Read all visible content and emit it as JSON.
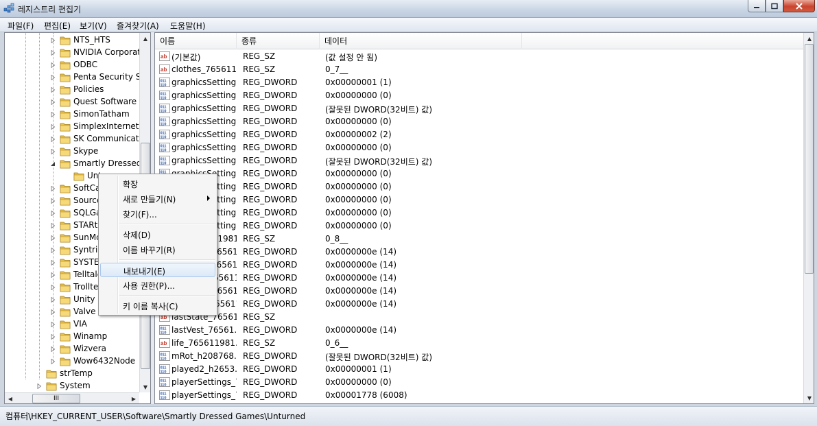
{
  "window": {
    "title": "레지스트리 편집기"
  },
  "menu": [
    "파일(F)",
    "편집(E)",
    "보기(V)",
    "즐겨찾기(A)",
    "도움말(H)"
  ],
  "tree": {
    "items": [
      {
        "label": "NTS_HTS"
      },
      {
        "label": "NVIDIA Corporati"
      },
      {
        "label": "ODBC"
      },
      {
        "label": "Penta Security Sy"
      },
      {
        "label": "Policies"
      },
      {
        "label": "Quest Software"
      },
      {
        "label": "SimonTatham"
      },
      {
        "label": "SimplexInternet"
      },
      {
        "label": "SK Communicatic"
      },
      {
        "label": "Skype"
      },
      {
        "label": "Smartly Dressed G"
      },
      {
        "label": "Unt"
      },
      {
        "label": "SoftCa"
      },
      {
        "label": "Source"
      },
      {
        "label": "SQLGa"
      },
      {
        "label": "STARtc"
      },
      {
        "label": "SunMc"
      },
      {
        "label": "Syntril"
      },
      {
        "label": "SYSTEI"
      },
      {
        "label": "Telltale"
      },
      {
        "label": "Trollted"
      },
      {
        "label": "Unity"
      },
      {
        "label": "Valve"
      },
      {
        "label": "VIA"
      },
      {
        "label": "Winamp"
      },
      {
        "label": "Wizvera"
      },
      {
        "label": "Wow6432Node"
      },
      {
        "label": "strTemp"
      },
      {
        "label": "System"
      }
    ],
    "hscroll_label": "III"
  },
  "list": {
    "columns": [
      "이름",
      "종류",
      "데이터"
    ],
    "rows": [
      {
        "icon": "string-value-icon",
        "name": "(기본값)",
        "type": "REG_SZ",
        "data": "(값 설정 안 됨)"
      },
      {
        "icon": "string-value-icon",
        "name": "clothes_765611...",
        "type": "REG_SZ",
        "data": "0_7__"
      },
      {
        "icon": "binary-value-icon",
        "name": "graphicsSetting...",
        "type": "REG_DWORD",
        "data": "0x00000001 (1)"
      },
      {
        "icon": "binary-value-icon",
        "name": "graphicsSetting...",
        "type": "REG_DWORD",
        "data": "0x00000000 (0)"
      },
      {
        "icon": "binary-value-icon",
        "name": "graphicsSetting...",
        "type": "REG_DWORD",
        "data": "(잘못된 DWORD(32비트) 값)"
      },
      {
        "icon": "binary-value-icon",
        "name": "graphicsSetting...",
        "type": "REG_DWORD",
        "data": "0x00000000 (0)"
      },
      {
        "icon": "binary-value-icon",
        "name": "graphicsSetting...",
        "type": "REG_DWORD",
        "data": "0x00000002 (2)"
      },
      {
        "icon": "binary-value-icon",
        "name": "graphicsSetting...",
        "type": "REG_DWORD",
        "data": "0x00000000 (0)"
      },
      {
        "icon": "binary-value-icon",
        "name": "graphicsSetting...",
        "type": "REG_DWORD",
        "data": "(잘못된 DWORD(32비트) 값)"
      },
      {
        "icon": "binary-value-icon",
        "name": "graphicsSetting...",
        "type": "REG_DWORD",
        "data": "0x00000000 (0)"
      },
      {
        "icon": "binary-value-icon",
        "name": "graphicsSetting...",
        "type": "REG_DWORD",
        "data": "0x00000000 (0)"
      },
      {
        "icon": "binary-value-icon",
        "name": "graphicsSetting...",
        "type": "REG_DWORD",
        "data": "0x00000000 (0)"
      },
      {
        "icon": "binary-value-icon",
        "name": "graphicsSetting...",
        "type": "REG_DWORD",
        "data": "0x00000000 (0)"
      },
      {
        "icon": "binary-value-icon",
        "name": "graphicsSetting...",
        "type": "REG_DWORD",
        "data": "0x00000000 (0)"
      },
      {
        "icon": "string-value-icon",
        "name": "hair_765611981...",
        "type": "REG_SZ",
        "data": "0_8__"
      },
      {
        "icon": "binary-value-icon",
        "name": "lastArms_765611...",
        "type": "REG_DWORD",
        "data": "0x0000000e (14)"
      },
      {
        "icon": "binary-value-icon",
        "name": "lastBody_765611...",
        "type": "REG_DWORD",
        "data": "0x0000000e (14)"
      },
      {
        "icon": "binary-value-icon",
        "name": "lastFeet_765611...",
        "type": "REG_DWORD",
        "data": "0x0000000e (14)"
      },
      {
        "icon": "binary-value-icon",
        "name": "lastHead_765611...",
        "type": "REG_DWORD",
        "data": "0x0000000e (14)"
      },
      {
        "icon": "binary-value-icon",
        "name": "lastLegs_765611...",
        "type": "REG_DWORD",
        "data": "0x0000000e (14)"
      },
      {
        "icon": "string-value-icon",
        "name": "lastState_76561...",
        "type": "REG_SZ",
        "data": ""
      },
      {
        "icon": "binary-value-icon",
        "name": "lastVest_76561...",
        "type": "REG_DWORD",
        "data": "0x0000000e (14)"
      },
      {
        "icon": "string-value-icon",
        "name": "life_765611981...",
        "type": "REG_SZ",
        "data": "0_6__"
      },
      {
        "icon": "binary-value-icon",
        "name": "mRot_h208768...",
        "type": "REG_DWORD",
        "data": "(잘못된 DWORD(32비트) 값)"
      },
      {
        "icon": "binary-value-icon",
        "name": "played2_h2653...",
        "type": "REG_DWORD",
        "data": "0x00000001 (1)"
      },
      {
        "icon": "binary-value-icon",
        "name": "playerSettings_7...",
        "type": "REG_DWORD",
        "data": "0x00000000 (0)"
      },
      {
        "icon": "binary-value-icon",
        "name": "playerSettings_7...",
        "type": "REG_DWORD",
        "data": "0x00001778 (6008)"
      }
    ]
  },
  "context_menu": {
    "items": [
      "확장",
      "새로 만들기(N)",
      "찾기(F)...",
      "삭제(D)",
      "이름 바꾸기(R)",
      "내보내기(E)",
      "사용 권한(P)...",
      "키 이름 복사(C)"
    ],
    "highlighted_index": 5
  },
  "status": {
    "path": "컴퓨터\\HKEY_CURRENT_USER\\Software\\Smartly Dressed Games\\Unturned"
  },
  "colors": {
    "folder": "#e8c24a",
    "highlight": "#dce9f8",
    "string_icon_red": "#c0392b",
    "binary_icon_blue": "#1f4fa8"
  }
}
